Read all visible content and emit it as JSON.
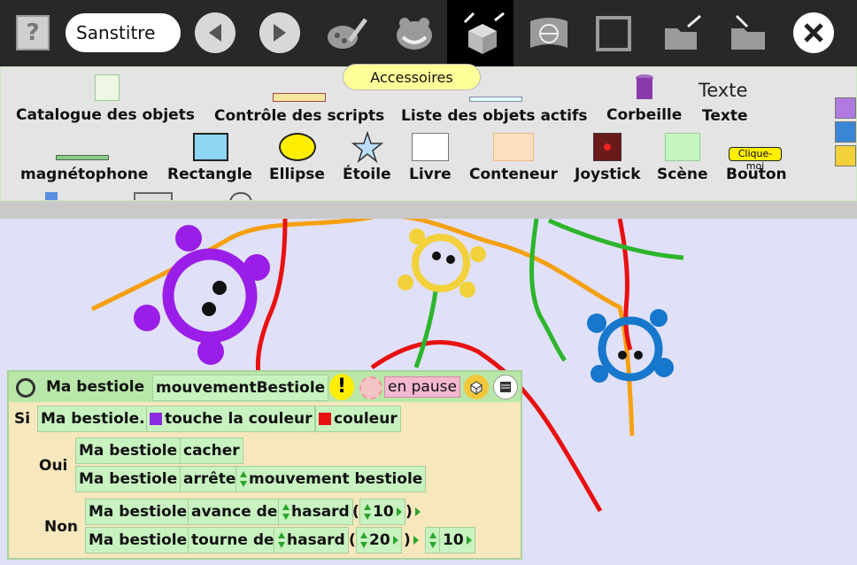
{
  "toolbar": {
    "project_title": "Sanstitre",
    "help_symbol": "?",
    "active_tool_tooltip": "Accessoires"
  },
  "supplies": [
    {
      "label": "Catalogue des objets",
      "icon": "catalog-icon"
    },
    {
      "label": "Contrôle des scripts",
      "icon": "script-control-icon"
    },
    {
      "label": "Liste des objets actifs",
      "icon": "active-objects-list-icon"
    },
    {
      "label": "Corbeille",
      "icon": "trash-icon"
    },
    {
      "label": "Texte",
      "icon": "text-icon",
      "preview": "Texte"
    },
    {
      "label": "magnétophone",
      "icon": "recorder-icon"
    },
    {
      "label": "Rectangle",
      "icon": "rectangle-icon"
    },
    {
      "label": "Ellipse",
      "icon": "ellipse-icon"
    },
    {
      "label": "Étoile",
      "icon": "star-icon"
    },
    {
      "label": "Livre",
      "icon": "book-icon"
    },
    {
      "label": "Conteneur",
      "icon": "container-icon"
    },
    {
      "label": "Joystick",
      "icon": "joystick-icon"
    },
    {
      "label": "Scène",
      "icon": "scene-icon"
    },
    {
      "label": "Bouton",
      "icon": "button-icon",
      "preview": "Clique-moi"
    }
  ],
  "script": {
    "object": "Ma bestiole",
    "name": "mouvementBestiole",
    "status": "en pause",
    "if_label": "Si",
    "yes_label": "Oui",
    "no_label": "Non",
    "condition": {
      "object": "Ma bestiole.",
      "test": "touche la couleur",
      "color_label": "couleur",
      "color_a": "#8c2be2",
      "color_b": "#e81010"
    },
    "yes_rows": [
      {
        "object": "Ma bestiole",
        "command": "cacher"
      },
      {
        "object": "Ma bestiole",
        "command": "arrête",
        "arg": "mouvement bestiole"
      }
    ],
    "no_rows": [
      {
        "object": "Ma bestiole",
        "command": "avance de",
        "func": "hasard",
        "open": "(",
        "num": "10",
        "close": ")"
      },
      {
        "object": "Ma bestiole",
        "command": "tourne de",
        "func": "hasard",
        "open": "(",
        "num": "20",
        "close": ")",
        "op": "-",
        "num2": "10"
      }
    ]
  },
  "colors": {
    "purple": "#9b1ee8",
    "yellow": "#f2d13a",
    "blue": "#1677cc",
    "red": "#e81010",
    "green": "#2cb52c",
    "orange": "#f5a00f"
  }
}
